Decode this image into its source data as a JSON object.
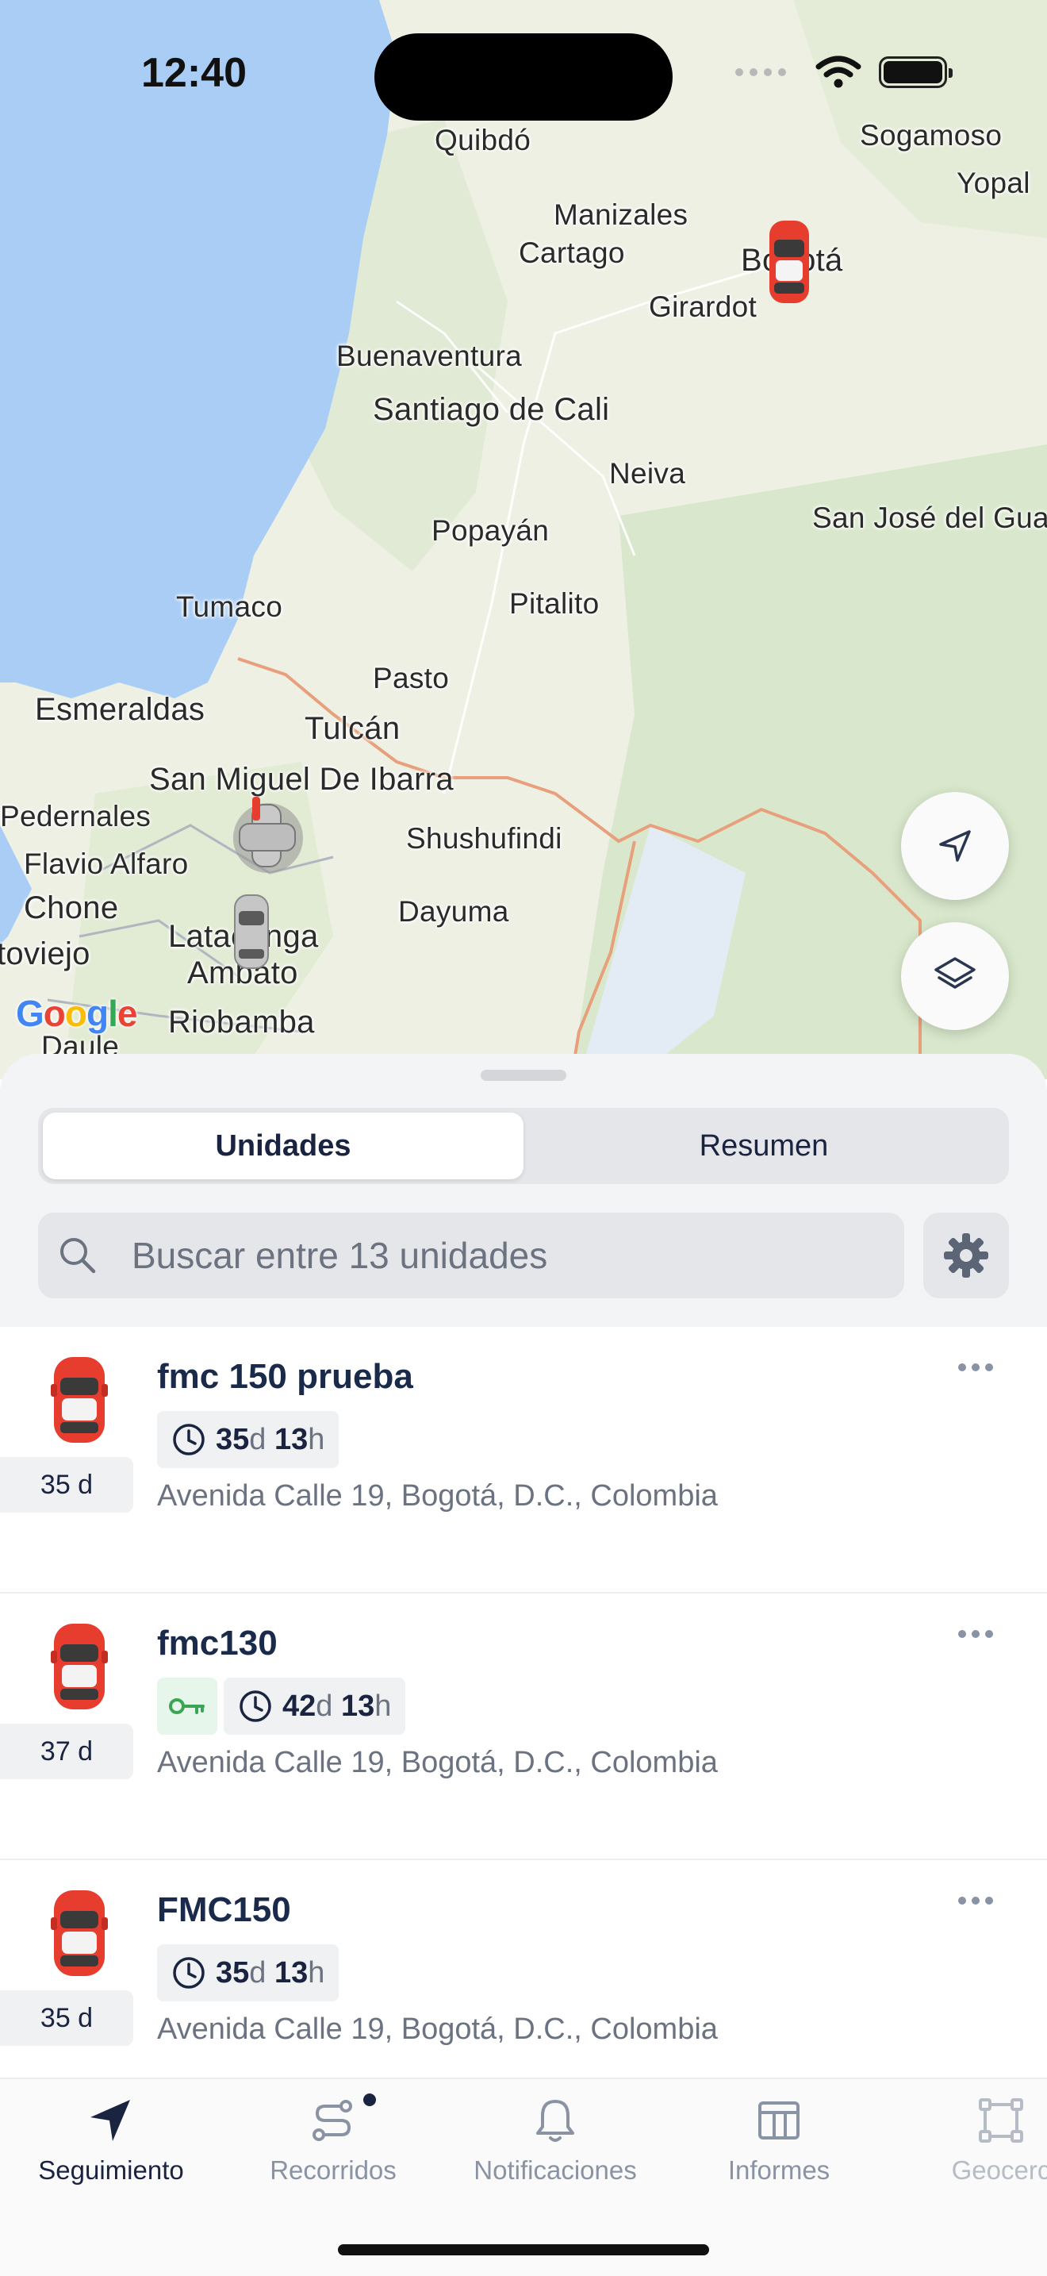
{
  "status_bar": {
    "time": "12:40"
  },
  "map": {
    "cities": [
      {
        "name": "Quibdó"
      },
      {
        "name": "Sogamoso"
      },
      {
        "name": "Yopal"
      },
      {
        "name": "Manizales"
      },
      {
        "name": "Cartago"
      },
      {
        "name": "Bogotá"
      },
      {
        "name": "Girardot"
      },
      {
        "name": "Buenaventura"
      },
      {
        "name": "Santiago de Cali"
      },
      {
        "name": "Neiva"
      },
      {
        "name": "Popayán"
      },
      {
        "name": "San José del Gua"
      },
      {
        "name": "Tumaco"
      },
      {
        "name": "Pitalito"
      },
      {
        "name": "Pasto"
      },
      {
        "name": "Esmeraldas"
      },
      {
        "name": "Tulcán"
      },
      {
        "name": "San Miguel De Ibarra"
      },
      {
        "name": "Pedernales"
      },
      {
        "name": "Shushufindi"
      },
      {
        "name": "Flavio Alfaro"
      },
      {
        "name": "Chone"
      },
      {
        "name": "Dayuma"
      },
      {
        "name": "Latacunga"
      },
      {
        "name": "toviejo"
      },
      {
        "name": "Ambato"
      },
      {
        "name": "Riobamba"
      },
      {
        "name": "Daule"
      }
    ],
    "attribution": "Google",
    "buttons": {
      "locate_icon": "navigation-arrow-icon",
      "layers_icon": "layers-icon"
    }
  },
  "sheet": {
    "tabs": [
      {
        "label": "Unidades",
        "active": true
      },
      {
        "label": "Resumen",
        "active": false
      }
    ],
    "search_placeholder": "Buscar entre 13 unidades",
    "settings_icon": "gear-icon"
  },
  "units": [
    {
      "name": "fmc 150 prueba",
      "age": "35 d",
      "days": "35",
      "days_unit": "d",
      "hours": "13",
      "hours_unit": "h",
      "key": false,
      "address": "Avenida Calle 19, Bogotá, D.C., Colombia"
    },
    {
      "name": "fmc130",
      "age": "37 d",
      "days": "42",
      "days_unit": "d",
      "hours": "13",
      "hours_unit": "h",
      "key": true,
      "address": "Avenida Calle 19, Bogotá, D.C., Colombia"
    },
    {
      "name": "FMC150",
      "age": "35 d",
      "days": "35",
      "days_unit": "d",
      "hours": "13",
      "hours_unit": "h",
      "key": false,
      "address": "Avenida Calle 19, Bogotá, D.C., Colombia"
    }
  ],
  "tabbar": [
    {
      "label": "Seguimiento",
      "icon": "navigation-arrow-icon",
      "active": true
    },
    {
      "label": "Recorridos",
      "icon": "route-icon",
      "active": false,
      "badge": true
    },
    {
      "label": "Notificaciones",
      "icon": "bell-icon",
      "active": false
    },
    {
      "label": "Informes",
      "icon": "table-icon",
      "active": false
    },
    {
      "label": "Geocerc",
      "icon": "geofence-icon",
      "active": false
    }
  ],
  "colors": {
    "ocean": "#a9cdf5",
    "land": "#eef0e4",
    "forest": "#dbe8cf",
    "border": "#e8a07c",
    "car_red": "#e63d2f",
    "key_green": "#3aa655"
  }
}
